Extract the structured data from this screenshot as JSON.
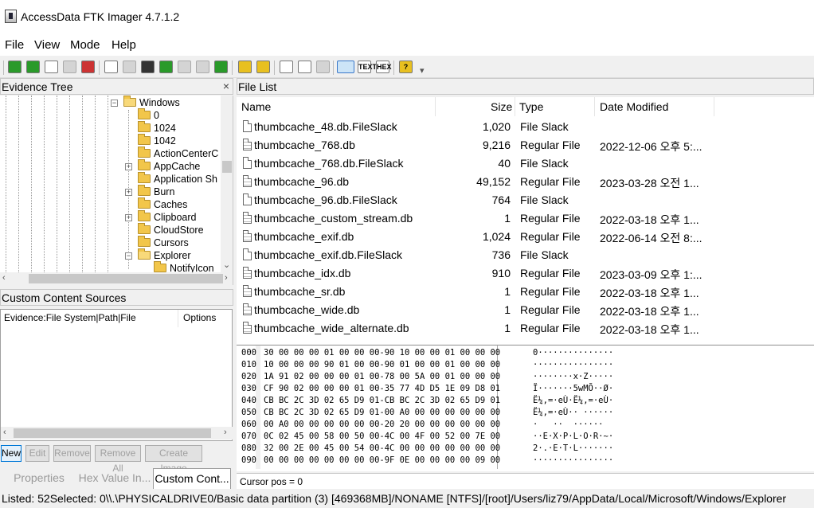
{
  "window": {
    "title": "AccessData FTK Imager 4.7.1.2"
  },
  "menu": [
    "File",
    "View",
    "Mode",
    "Help"
  ],
  "toolbar": [
    "add-evidence-icon",
    "add-all-evidence-icon",
    "image-mounting-icon",
    "remove-evidence-icon",
    "remove-all-evidence-icon",
    "create-disk-image-icon",
    "export-disk-image-icon",
    "export-logical-image-icon",
    "add-to-custom-content-icon",
    "create-custom-content-image-icon",
    "decrypt-ad1-icon",
    "verify-drive-icon",
    "capture-memory-icon",
    "obtain-protected-files-icon",
    "detect-efs-encryption-icon",
    "export-files-icon",
    "export-file-hash-list-icon",
    "export-directory-listing-icon",
    "auto-view-icon",
    "text-view-icon",
    "hex-view-icon",
    "help-icon"
  ],
  "toolbar_text": {
    "text_view": "TEXT",
    "hex_view": "HEX",
    "help": "?"
  },
  "evidence_tree": {
    "title": "Evidence Tree",
    "close": "×",
    "items": [
      {
        "label": "Windows",
        "expanded": true,
        "has_children": true
      },
      {
        "label": "0",
        "expanded": false,
        "has_children": false
      },
      {
        "label": "1024",
        "expanded": false,
        "has_children": false
      },
      {
        "label": "1042",
        "expanded": false,
        "has_children": false
      },
      {
        "label": "ActionCenterC",
        "expanded": false,
        "has_children": false
      },
      {
        "label": "AppCache",
        "expanded": false,
        "has_children": true
      },
      {
        "label": "Application Sh",
        "expanded": false,
        "has_children": false
      },
      {
        "label": "Burn",
        "expanded": false,
        "has_children": true
      },
      {
        "label": "Caches",
        "expanded": false,
        "has_children": false
      },
      {
        "label": "Clipboard",
        "expanded": false,
        "has_children": true
      },
      {
        "label": "CloudStore",
        "expanded": false,
        "has_children": false
      },
      {
        "label": "Cursors",
        "expanded": false,
        "has_children": false
      },
      {
        "label": "Explorer",
        "expanded": true,
        "has_children": true
      },
      {
        "label": "NotifyIcon",
        "expanded": false,
        "has_children": false
      }
    ]
  },
  "custom_content": {
    "title": "Custom Content Sources",
    "columns": [
      "Evidence:File System|Path|File",
      "Options"
    ],
    "buttons": [
      {
        "label": "New",
        "enabled": true
      },
      {
        "label": "Edit",
        "enabled": false
      },
      {
        "label": "Remove",
        "enabled": false
      },
      {
        "label": "Remove All",
        "enabled": false
      },
      {
        "label": "Create Image",
        "enabled": false
      }
    ]
  },
  "bottom_tabs": [
    {
      "label": "Properties",
      "active": false
    },
    {
      "label": "Hex Value In...",
      "active": false
    },
    {
      "label": "Custom Cont...",
      "active": true
    }
  ],
  "file_list": {
    "title": "File List",
    "columns": {
      "name": "Name",
      "size": "Size",
      "type": "Type",
      "date": "Date Modified"
    },
    "rows": [
      {
        "name": "thumbcache_48.db.FileSlack",
        "size": "1,020",
        "type": "File Slack",
        "date": "",
        "icon": "slack"
      },
      {
        "name": "thumbcache_768.db",
        "size": "9,216",
        "type": "Regular File",
        "date": "2022-12-06 오후 5:...",
        "icon": "regular"
      },
      {
        "name": "thumbcache_768.db.FileSlack",
        "size": "40",
        "type": "File Slack",
        "date": "",
        "icon": "slack"
      },
      {
        "name": "thumbcache_96.db",
        "size": "49,152",
        "type": "Regular File",
        "date": "2023-03-28 오전 1...",
        "icon": "regular"
      },
      {
        "name": "thumbcache_96.db.FileSlack",
        "size": "764",
        "type": "File Slack",
        "date": "",
        "icon": "slack"
      },
      {
        "name": "thumbcache_custom_stream.db",
        "size": "1",
        "type": "Regular File",
        "date": "2022-03-18 오후 1...",
        "icon": "regular"
      },
      {
        "name": "thumbcache_exif.db",
        "size": "1,024",
        "type": "Regular File",
        "date": "2022-06-14 오전 8:...",
        "icon": "regular"
      },
      {
        "name": "thumbcache_exif.db.FileSlack",
        "size": "736",
        "type": "File Slack",
        "date": "",
        "icon": "slack"
      },
      {
        "name": "thumbcache_idx.db",
        "size": "910",
        "type": "Regular File",
        "date": "2023-03-09 오후 1:...",
        "icon": "regular"
      },
      {
        "name": "thumbcache_sr.db",
        "size": "1",
        "type": "Regular File",
        "date": "2022-03-18 오후 1...",
        "icon": "regular"
      },
      {
        "name": "thumbcache_wide.db",
        "size": "1",
        "type": "Regular File",
        "date": "2022-03-18 오후 1...",
        "icon": "regular"
      },
      {
        "name": "thumbcache_wide_alternate.db",
        "size": "1",
        "type": "Regular File",
        "date": "2022-03-18 오후 1...",
        "icon": "regular"
      }
    ]
  },
  "hex_view": {
    "rows": [
      {
        "offset": "000",
        "hex": "30 00 00 00 01 00 00 00-90 10 00 00 01 00 00 00",
        "ascii": "0···············"
      },
      {
        "offset": "010",
        "hex": "10 00 00 00 90 01 00 00-90 01 00 00 01 00 00 00",
        "ascii": "················"
      },
      {
        "offset": "020",
        "hex": "1A 91 02 00 00 00 01 00-78 00 5A 00 01 00 00 00",
        "ascii": "········x·Z·····"
      },
      {
        "offset": "030",
        "hex": "CF 90 02 00 00 00 01 00-35 77 4D D5 1E 09 D8 01",
        "ascii": "Ï·······5wMÕ··Ø·"
      },
      {
        "offset": "040",
        "hex": "CB BC 2C 3D 02 65 D9 01-CB BC 2C 3D 02 65 D9 01",
        "ascii": "Ë¼,=·eÙ·Ë¼,=·eÙ·"
      },
      {
        "offset": "050",
        "hex": "CB BC 2C 3D 02 65 D9 01-00 A0 00 00 00 00 00 00",
        "ascii": "Ë¼,=·eÙ·· ······"
      },
      {
        "offset": "060",
        "hex": "00 A0 00 00 00 00 00 00-20 20 00 00 00 00 00 00",
        "ascii": "·   ··  ······"
      },
      {
        "offset": "070",
        "hex": "0C 02 45 00 58 00 50 00-4C 00 4F 00 52 00 7E 00",
        "ascii": "··E·X·P·L·O·R·~·"
      },
      {
        "offset": "080",
        "hex": "32 00 2E 00 45 00 54 00-4C 00 00 00 00 00 00 00",
        "ascii": "2·.·E·T·L·······"
      },
      {
        "offset": "090",
        "hex": "00 00 00 00 00 00 00 00-9F 0E 00 00 00 00 09 00",
        "ascii": "················"
      }
    ],
    "cursor_pos": "Cursor pos = 0"
  },
  "status": "Listed: 52Selected: 0\\\\.\\PHYSICALDRIVE0/Basic data partition (3) [469368MB]/NONAME [NTFS]/[root]/Users/liz79/AppData/Local/Microsoft/Windows/Explorer"
}
